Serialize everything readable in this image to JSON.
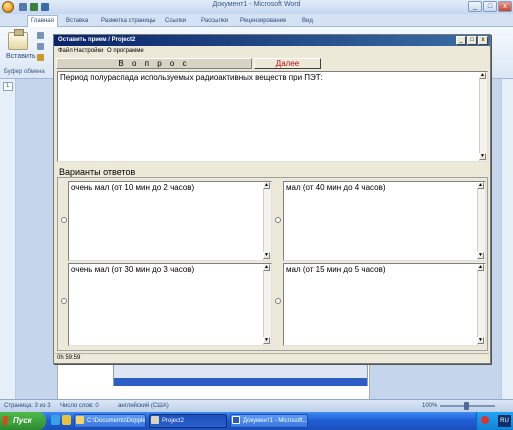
{
  "word": {
    "window_title": "Документ1 - Microsoft Word",
    "ribbon_tabs": [
      "Главная",
      "Вставка",
      "Разметка страницы",
      "Ссылки",
      "Рассылки",
      "Рецензирование",
      "Вид"
    ],
    "paste_label": "Вставить",
    "clipboard_label": "Буфер обмена",
    "ruler_tab": "L",
    "status": {
      "page": "Страница: 3 из 3",
      "words": "Число слов: 0",
      "language": "английский (США)",
      "zoom": "100%"
    },
    "window_controls": {
      "minimize": "_",
      "maximize": "□",
      "close": "x"
    }
  },
  "dialog": {
    "title": "Оставить прием / Project2",
    "menu": [
      "Файл",
      "Настройки",
      "О программе"
    ],
    "question_heading": "В о п р о с",
    "next_button": "Далее",
    "question_text": "Период полураспада используемых радиоактивных веществ при ПЭТ:",
    "answers_heading": "Варианты ответов",
    "answers": [
      {
        "text": "очень мал (от 10 мин до 2 часов)",
        "selected": false
      },
      {
        "text": "мал (от 40 мин до 4 часов)",
        "selected": false
      },
      {
        "text": "очень мал (от 30 мин до 3 часов)",
        "selected": false
      },
      {
        "text": "мал (от 15 мин до 5 часов)",
        "selected": false
      }
    ],
    "timer": "0h 59:59",
    "controls": {
      "minimize": "_",
      "maximize": "□",
      "close": "x"
    }
  },
  "taskbar": {
    "start_label": "Пуск",
    "tasks": [
      {
        "label": "C:\\Documents\\Doppler\\Proj...",
        "active": false
      },
      {
        "label": "Project2",
        "active": true
      },
      {
        "label": "Документ1 - Microsoft...",
        "active": false
      }
    ],
    "clock": "RU"
  },
  "colors": {
    "titlebar_start": "#0a246a",
    "titlebar_end": "#3a6ea5",
    "next_button_text": "#c01010",
    "taskbar": "#1f5fd6",
    "start": "#2e8b2e"
  }
}
